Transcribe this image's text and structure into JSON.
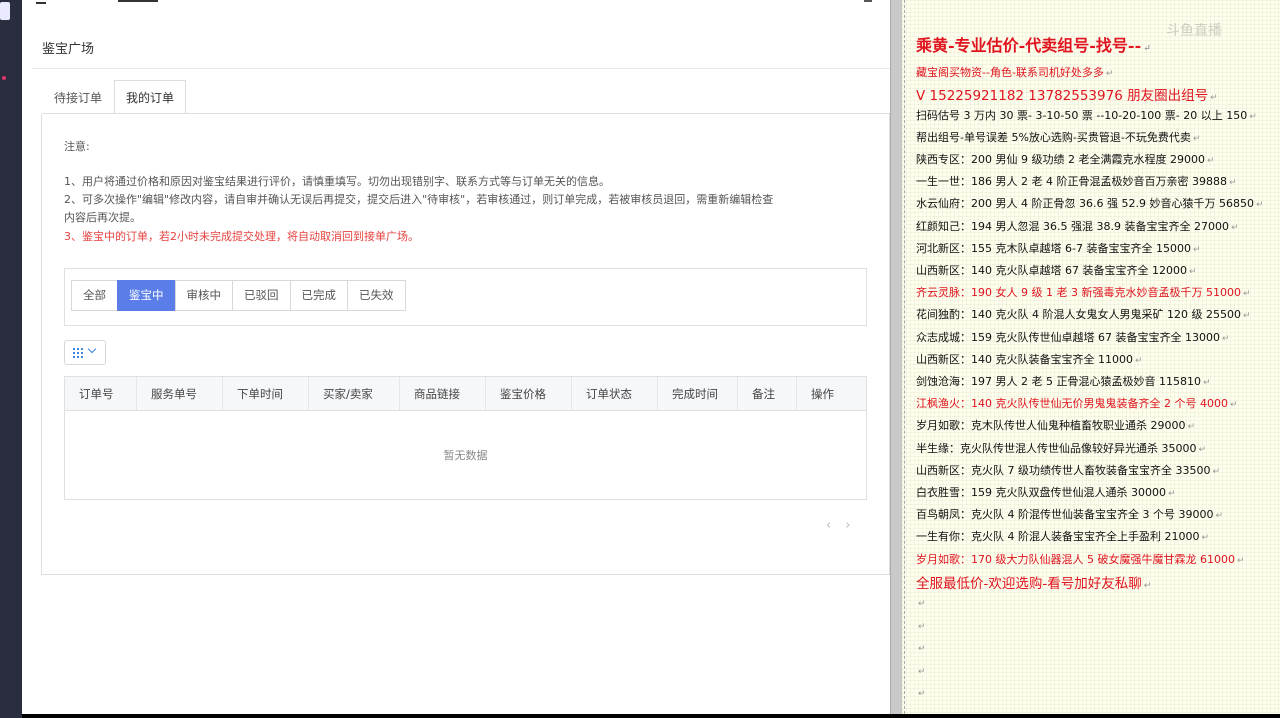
{
  "app": {
    "page_title": "鉴宝广场",
    "tabs": [
      {
        "label": "待接订单",
        "active": false
      },
      {
        "label": "我的订单",
        "active": true
      }
    ],
    "notice": {
      "title": "注意:",
      "lines": [
        "1、用户将通过价格和原因对鉴宝结果进行评价，请慎重填写。切勿出现错别字、联系方式等与订单无关的信息。",
        "2、可多次操作\"编辑\"修改内容，请自审并确认无误后再提交，提交后进入\"待审核\"，若审核通过，则订单完成，若被审核员退回，需重新编辑检查",
        "内容后再次提。",
        "3、鉴宝中的订单，若2小时未完成提交处理，将自动取消回到接单广场。"
      ]
    },
    "filters": [
      {
        "label": "全部",
        "active": false
      },
      {
        "label": "鉴宝中",
        "active": true
      },
      {
        "label": "审核中",
        "active": false
      },
      {
        "label": "已驳回",
        "active": false
      },
      {
        "label": "已完成",
        "active": false
      },
      {
        "label": "已失效",
        "active": false
      }
    ],
    "columns_button_icon": "grid-icon",
    "table": {
      "headers": [
        "订单号",
        "服务单号",
        "下单时间",
        "买家/卖家",
        "商品链接",
        "鉴宝价格",
        "订单状态",
        "完成时间",
        "备注",
        "操作"
      ],
      "empty_text": "暂无数据"
    },
    "pager": {
      "prev": "‹",
      "next": "›"
    },
    "accent_color": "#5a7de8",
    "warning_color": "#e64340"
  },
  "notes_panel": {
    "watermark": "斗鱼直播",
    "lines": [
      {
        "text": "乘黄-专业估价-代卖组号-找号--",
        "style": "h1"
      },
      {
        "text": "藏宝阁买物资--角色-联系司机好处多多",
        "style": "red"
      },
      {
        "text": "V 15225921182   13782553976 朋友圈出组号",
        "style": "h2"
      },
      {
        "text": "扫码估号 3 万内 30 票- 3-10-50 票  --10-20-100 票- 20 以上 150",
        "style": "normal"
      },
      {
        "text": "帮出组号-单号误差 5%放心选购-买贵管退-不玩免费代卖",
        "style": "normal"
      },
      {
        "text": "陕西专区：200 男仙 9 级功绩 2 老全满霞克水程度 29000",
        "style": "normal"
      },
      {
        "text": "一生一世：186 男人 2 老 4 阶正骨混孟极妙音百万亲密 39888",
        "style": "normal"
      },
      {
        "text": "水云仙府：200 男人 4 阶正骨忽 36.6 强 52.9 妙音心猿千万 56850",
        "style": "normal"
      },
      {
        "text": "红颜知己：194 男人忽混 36.5 强混 38.9 装备宝宝齐全 27000",
        "style": "normal"
      },
      {
        "text": "河北新区：155 克木队卓越塔 6-7 装备宝宝齐全 15000",
        "style": "normal"
      },
      {
        "text": "山西新区：140 克火队卓越塔 67 装备宝宝齐全 12000",
        "style": "normal"
      },
      {
        "text": "齐云灵脉：190 女人 9 级 1 老 3 新强毒克水妙音孟极千万 51000",
        "style": "red"
      },
      {
        "text": "花间独酌：140 克火队 4 阶混人女鬼女人男鬼采矿 120 级 25500",
        "style": "normal"
      },
      {
        "text": "众志成城：159 克火队传世仙卓越塔 67 装备宝宝齐全 13000",
        "style": "normal"
      },
      {
        "text": "山西新区：140 克火队装备宝宝齐全 11000",
        "style": "normal"
      },
      {
        "text": "剑蚀沧海：197 男人 2 老 5 正骨混心猿孟极妙音 115810",
        "style": "normal"
      },
      {
        "text": "江枫渔火：140 克火队传世仙无价男鬼鬼装备齐全 2 个号 4000",
        "style": "red"
      },
      {
        "text": "岁月如歌：克木队传世人仙鬼种植畜牧职业通杀 29000",
        "style": "normal"
      },
      {
        "text": "半生缘：克火队传世混人传世仙品像较好异光通杀 35000",
        "style": "normal"
      },
      {
        "text": "山西新区：克火队 7 级功绩传世人畜牧装备宝宝齐全 33500",
        "style": "normal"
      },
      {
        "text": "白衣胜雪：159 克火队双盘传世仙混人通杀 30000",
        "style": "normal"
      },
      {
        "text": "百鸟朝凤：克火队 4 阶混传世仙装备宝宝齐全 3 个号 39000",
        "style": "normal"
      },
      {
        "text": "一生有你：克火队 4 阶混人装备宝宝齐全上手盈利 21000",
        "style": "normal"
      },
      {
        "text": "岁月如歌：170 级大力队仙器混人 5 破女魔强牛魔甘霖龙 61000",
        "style": "red"
      },
      {
        "text": "全服最低价-欢迎选购-看号加好友私聊",
        "style": "h2"
      }
    ],
    "empty_paragraph_count": 5,
    "paragraph_mark": "↵"
  }
}
